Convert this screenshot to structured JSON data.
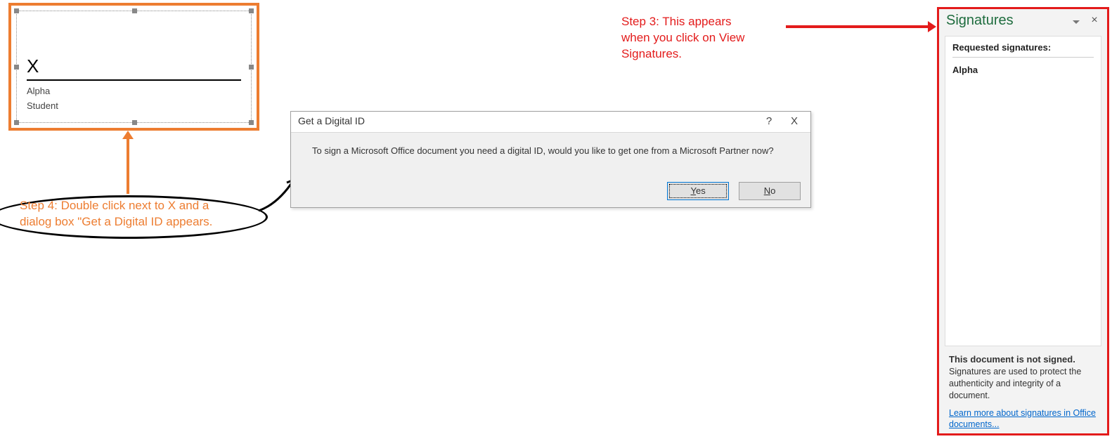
{
  "signature_box": {
    "x_label": "X",
    "signer_name": "Alpha",
    "signer_role": "Student"
  },
  "annotations": {
    "step3": "Step 3: This appears\nwhen you click on View\nSignatures.",
    "step4": "Step 4: Double click next to X and a\ndialog box \"Get a Digital ID appears."
  },
  "dialog": {
    "title": "Get a Digital ID",
    "message": "To sign a Microsoft Office document you need a digital ID, would you like to get one from a Microsoft Partner now?",
    "help_label": "?",
    "close_label": "X",
    "yes_prefix": "Y",
    "yes_suffix": "es",
    "no_prefix": "N",
    "no_suffix": "o"
  },
  "pane": {
    "title": "Signatures",
    "close_label": "×",
    "section": "Requested signatures:",
    "item": "Alpha",
    "status": "This document is not signed.",
    "desc": "Signatures are used to protect the authenticity and integrity of a document.",
    "link": "Learn more about signatures in Office documents..."
  }
}
